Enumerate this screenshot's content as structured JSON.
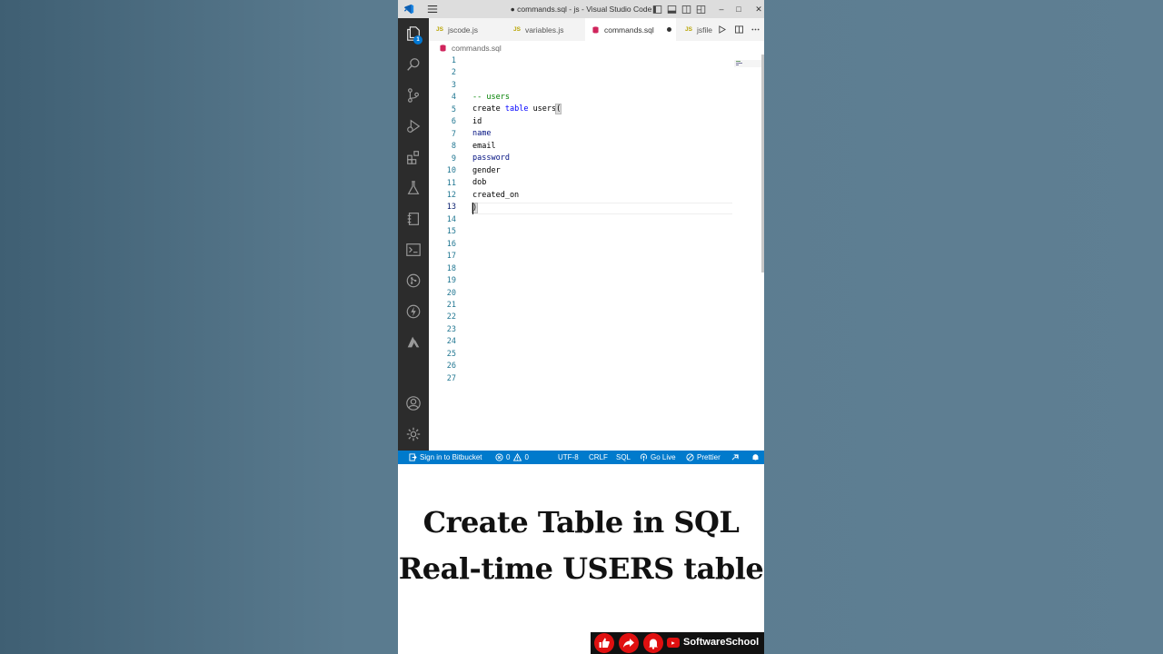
{
  "window": {
    "title": "● commands.sql - js - Visual Studio Code",
    "controls": {
      "minimize": "–",
      "maximize": "□",
      "close": "✕"
    }
  },
  "activity_bar": {
    "explorer_badge": "1",
    "items": [
      "explorer-icon",
      "search-icon",
      "source-control-icon",
      "run-debug-icon",
      "extensions-icon",
      "testing-icon",
      "notebook-icon",
      "terminal-icon",
      "git-graph-icon",
      "thunder-icon",
      "azure-icon",
      "account-icon",
      "settings-gear-icon"
    ]
  },
  "tabs": [
    {
      "label": "jscode.js",
      "badge": "JS"
    },
    {
      "label": "variables.js",
      "badge": "JS"
    },
    {
      "label": "commands.sql",
      "active": true,
      "dirty": true
    },
    {
      "label": "jsfile",
      "badge": "JS"
    }
  ],
  "breadcrumb": {
    "file": "commands.sql"
  },
  "editor": {
    "line_numbers": [
      "1",
      "2",
      "3",
      "4",
      "5",
      "6",
      "7",
      "8",
      "9",
      "10",
      "11",
      "12",
      "13",
      "14",
      "15",
      "16",
      "17",
      "18",
      "19",
      "20",
      "21",
      "22",
      "23",
      "24",
      "25",
      "26",
      "27"
    ],
    "current_line": "13",
    "code": {
      "l4": "-- users",
      "l5_kw1": "create",
      "l5_kw2": "table",
      "l5_name": "users",
      "l5_paren": "(",
      "l6": "id",
      "l7": "name",
      "l8": "email",
      "l9": "password",
      "l10": "gender",
      "l11": "dob",
      "l12": "created_on",
      "l13": ")"
    }
  },
  "status_bar": {
    "bitbucket": "Sign in to Bitbucket",
    "errors": "0",
    "warnings": "0",
    "encoding": "UTF-8",
    "eol": "CRLF",
    "language": "SQL",
    "go_live": "Go Live",
    "prettier": "Prettier"
  },
  "caption": {
    "line1": "Create Table in SQL",
    "line2": "Real-time USERS table"
  },
  "subscribe_strip": {
    "channel": "SoftwareSchool"
  },
  "colors": {
    "status_bar": "#007acc",
    "activity_bar": "#2c2c2c",
    "comment": "#008000",
    "keyword": "#0000ff",
    "identifier": "#001080",
    "line_number": "#237893",
    "brand_red": "#e01010"
  }
}
